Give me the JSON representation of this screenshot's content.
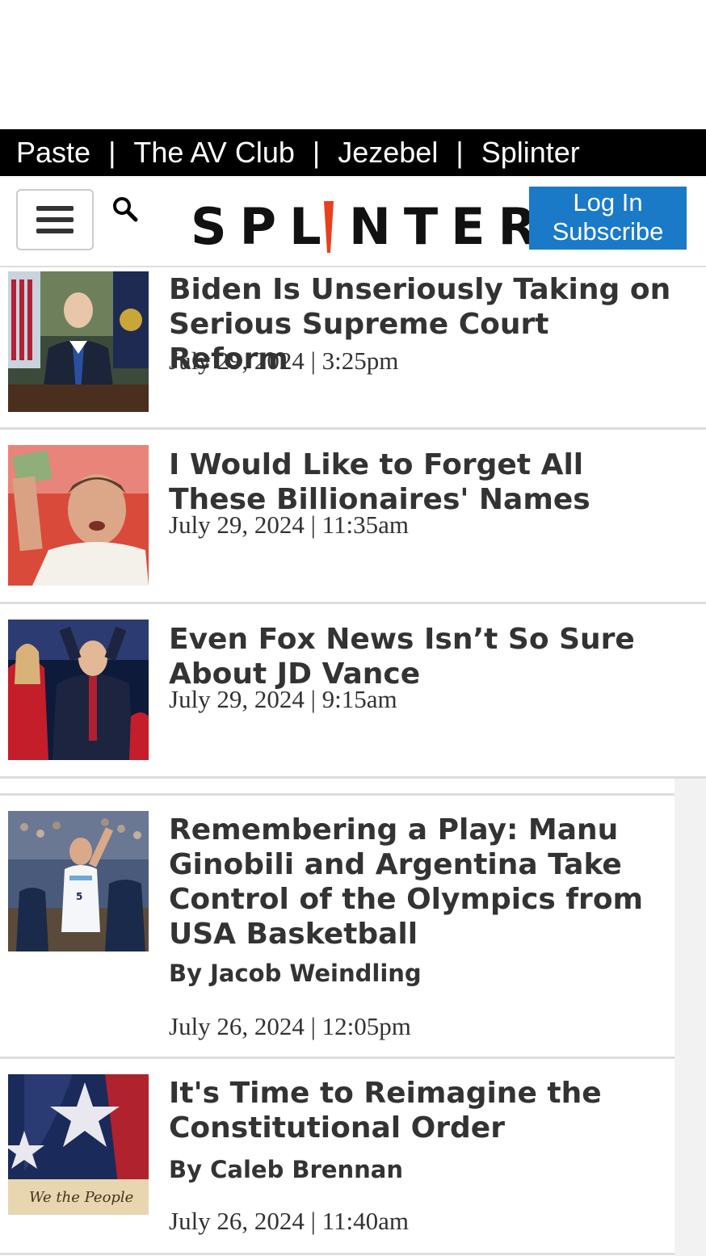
{
  "network": {
    "links": [
      "Paste",
      "The AV Club",
      "Jezebel",
      "Splinter"
    ],
    "separator": "|"
  },
  "header": {
    "logo": "SPLINTER",
    "login_label": "Log In",
    "subscribe_label": "Subscribe",
    "icons": [
      "hamburger-menu-icon",
      "search-icon"
    ]
  },
  "colors": {
    "network_bar": "#000000",
    "accent_blue": "#1a7ac7",
    "logo_i": "#e8401c",
    "text": "#333333"
  },
  "articles": [
    {
      "title": "Biden Is Unseriously Taking on Serious Supreme Court Reform",
      "byline": "",
      "date": "July 29, 2024 | 3:25pm"
    },
    {
      "title": "I Would Like to Forget All These Billionaires' Names",
      "byline": "",
      "date": "July 29, 2024 | 11:35am"
    },
    {
      "title": "Even Fox News Isn’t So Sure About JD Vance",
      "byline": "",
      "date": "July 29, 2024 | 9:15am"
    },
    {
      "title": "Remembering a Play: Manu Ginobili and Argentina Take Control of the Olympics from USA Basketball",
      "byline": "By Jacob Weindling",
      "date": "July 26, 2024 | 12:05pm"
    },
    {
      "title": "It's Time to Reimagine the Constitutional Order",
      "byline": "By Caleb Brennan",
      "date": "July 26, 2024 | 11:40am"
    }
  ]
}
